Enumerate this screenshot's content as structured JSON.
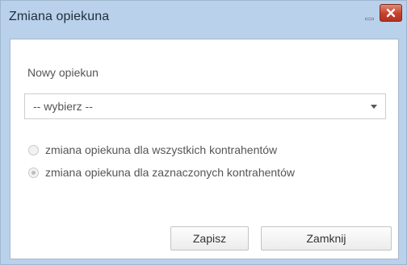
{
  "window": {
    "title": "Zmiana opiekuna",
    "minimize_icon": "minimize-icon",
    "close_icon": "close-icon"
  },
  "form": {
    "owner_label": "Nowy opiekun",
    "owner_select": {
      "selected": "-- wybierz --"
    },
    "scope_options": [
      {
        "label": "zmiana opiekuna dla wszystkich kontrahentów",
        "checked": false
      },
      {
        "label": "zmiana opiekuna dla zaznaczonych kontrahentów",
        "checked": true
      }
    ]
  },
  "buttons": {
    "save_label": "Zapisz",
    "close_label": "Zamknij"
  },
  "colors": {
    "titlebar": "#b9d1ea",
    "close_button": "#c7402a",
    "text": "#555555"
  }
}
